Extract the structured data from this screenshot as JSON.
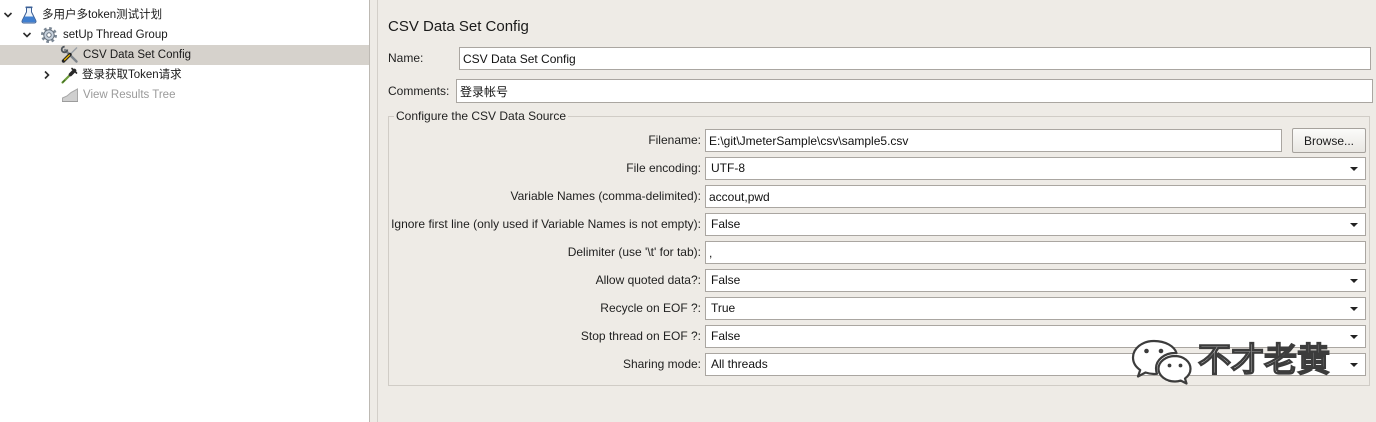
{
  "tree": {
    "root": {
      "label": "多用户多token测试计划",
      "icon": "test-plan-icon",
      "expanded": true,
      "children": [
        {
          "label": "setUp Thread Group",
          "icon": "gear-icon",
          "expanded": true,
          "children": [
            {
              "label": "CSV Data Set Config",
              "icon": "tools-icon",
              "selected": true
            },
            {
              "label": "登录获取Token请求",
              "icon": "pipette-icon",
              "expanded": false
            },
            {
              "label": "View Results Tree",
              "icon": "chart-icon",
              "disabled": true
            }
          ]
        }
      ]
    }
  },
  "editor": {
    "title": "CSV Data Set Config",
    "name": {
      "label": "Name:",
      "value": "CSV Data Set Config"
    },
    "comments": {
      "label": "Comments:",
      "value": "登录帐号"
    },
    "csv_source": {
      "title": "Configure the CSV Data Source",
      "browse_label": "Browse...",
      "fields": [
        {
          "label": "Filename:",
          "value": "E:\\git\\JmeterSample\\csv\\sample5.csv"
        },
        {
          "label": "File encoding:",
          "value": "UTF-8"
        },
        {
          "label": "Variable Names (comma-delimited):",
          "value": "accout,pwd"
        },
        {
          "label": "Ignore first line (only used if Variable Names is not empty):",
          "value": "False"
        },
        {
          "label": "Delimiter (use '\\t' for tab):",
          "value": ","
        },
        {
          "label": "Allow quoted data?:",
          "value": "False"
        },
        {
          "label": "Recycle on EOF ?:",
          "value": "True"
        },
        {
          "label": "Stop thread on EOF ?:",
          "value": "False"
        },
        {
          "label": "Sharing mode:",
          "value": "All threads"
        }
      ]
    }
  },
  "watermark": {
    "icon": "wechat-icon",
    "text": "不才老黄"
  },
  "colors": {
    "panel_background": "#eeebe6",
    "tree_background": "#ffffff",
    "selection": "#d6d2cc",
    "disabled_text": "#9a9a9a",
    "watermark_stroke": "#3c3c3c"
  }
}
